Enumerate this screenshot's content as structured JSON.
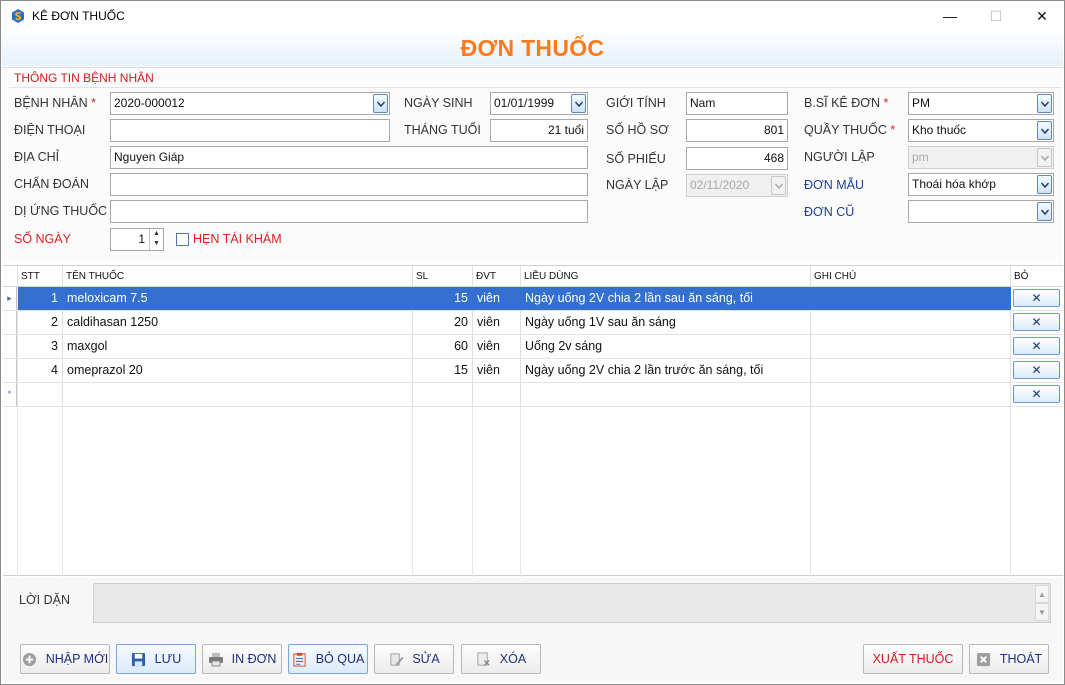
{
  "window": {
    "title": "KÊ ĐƠN THUỐC"
  },
  "header": {
    "title": "ĐƠN THUỐC"
  },
  "patient_section": {
    "heading": "THÔNG TIN BỆNH NHÂN",
    "benh_nhan": {
      "label": "BỆNH NHÂN",
      "required": "*",
      "value": "2020-000012"
    },
    "dien_thoai": {
      "label": "ĐIỆN THOẠI",
      "value": ""
    },
    "dia_chi": {
      "label": "ĐỊA CHỈ",
      "value": "Nguyen Giáp"
    },
    "chan_doan": {
      "label": "CHẨN ĐOÁN",
      "value": ""
    },
    "di_ung_thuoc": {
      "label": "DỊ ỨNG THUỐC",
      "value": ""
    },
    "so_ngay": {
      "label": "SỐ NGÀY",
      "value": "1"
    },
    "hen_tai_kham": {
      "label": "HẸN TÁI KHÁM",
      "checked": false
    },
    "ngay_sinh": {
      "label": "NGÀY SINH",
      "value": "01/01/1999"
    },
    "thang_tuoi": {
      "label": "THÁNG TUỔI",
      "value": "21 tuổi"
    },
    "gioi_tinh": {
      "label": "GIỚI TÍNH",
      "value": "Nam"
    },
    "so_ho_so": {
      "label": "SỐ HỒ SƠ",
      "value": "801"
    },
    "so_phieu": {
      "label": "SỐ PHIẾU",
      "value": "468"
    },
    "ngay_lap": {
      "label": "NGÀY LẬP",
      "value": "02/11/2020"
    },
    "bs_ke_don": {
      "label": "B.SĨ KÊ ĐƠN",
      "required": "*",
      "value": "PM"
    },
    "quay_thuoc": {
      "label": "QUẦY THUỐC",
      "required": "*",
      "value": "Kho thuốc"
    },
    "nguoi_lap": {
      "label": "NGƯỜI LẬP",
      "value": "pm"
    },
    "don_mau": {
      "label": "ĐƠN MẪU",
      "value": "Thoái hóa khớp"
    },
    "don_cu": {
      "label": "ĐƠN CŨ",
      "value": ""
    }
  },
  "grid": {
    "columns": {
      "stt": "STT",
      "ten_thuoc": "TÊN THUỐC",
      "sl": "SL",
      "dvt": "ĐVT",
      "lieu_dung": "LIỀU DÙNG",
      "ghi_chu": "GHI CHÚ",
      "bo": "BỎ"
    },
    "rows": [
      {
        "stt": "1",
        "ten_thuoc": "meloxicam 7.5",
        "sl": "15",
        "dvt": "viên",
        "lieu_dung": "Ngày uống 2V chia 2 lần sau ăn sáng, tối",
        "ghi_chu": "",
        "selected": true
      },
      {
        "stt": "2",
        "ten_thuoc": "caldihasan 1250",
        "sl": "20",
        "dvt": "viên",
        "lieu_dung": "Ngày uống 1V sau ăn sáng",
        "ghi_chu": ""
      },
      {
        "stt": "3",
        "ten_thuoc": "maxgol",
        "sl": "60",
        "dvt": "viên",
        "lieu_dung": "Uống 2v sáng",
        "ghi_chu": ""
      },
      {
        "stt": "4",
        "ten_thuoc": "omeprazol 20",
        "sl": "15",
        "dvt": "viên",
        "lieu_dung": "Ngày uống 2V chia 2 lần trước ăn sáng, tối",
        "ghi_chu": ""
      }
    ],
    "current_row_marker": "▸",
    "new_row_marker": "*",
    "remove_glyph": "✕"
  },
  "notes": {
    "label": "LỜI DẶN",
    "value": ""
  },
  "toolbar": {
    "nhap_moi": "NHẬP MỚI",
    "luu": "LƯU",
    "in_don": "IN ĐƠN",
    "bo_qua": "BỎ QUA",
    "sua": "SỬA",
    "xoa": "XÓA",
    "xuat_thuoc": "XUẤT THUỐC",
    "thoat": "THOÁT"
  },
  "colors": {
    "accent_orange": "#ff7a1a",
    "required_red": "#e02020",
    "selection_blue": "#3370cf",
    "link_blue": "#1f3f95"
  },
  "icons": {
    "app": "app-logo-icon",
    "dropdown": "chevron-down-icon",
    "add": "plus-circle-icon",
    "save": "floppy-icon",
    "print": "printer-icon",
    "skip": "clipboard-icon",
    "edit": "pencil-icon",
    "delete": "delete-doc-icon",
    "exit": "close-box-icon"
  }
}
